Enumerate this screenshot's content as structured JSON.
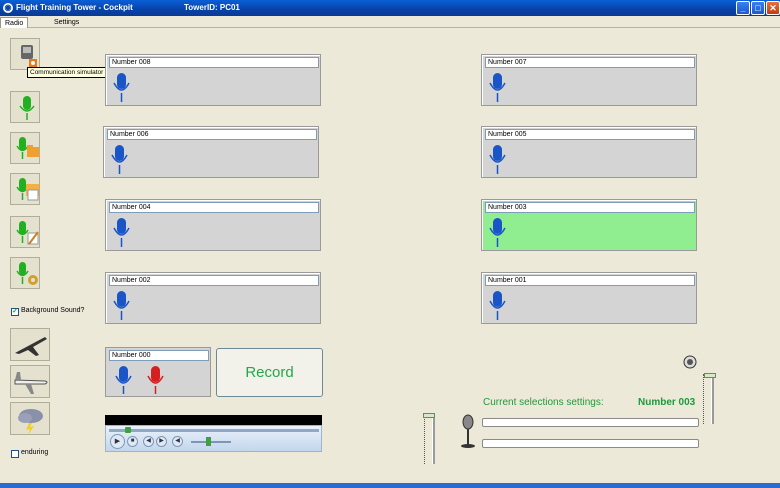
{
  "window": {
    "title": "Flight Training Tower - Cockpit",
    "tower_id": "TowerID: PC01",
    "controls": [
      "minimize-icon",
      "maximize-icon",
      "close-icon"
    ]
  },
  "tabs": [
    {
      "label": "Radio",
      "active": true
    },
    {
      "label": "Settings",
      "active": false
    }
  ],
  "toolbar": {
    "tooltip": "Communication simulator Power Off",
    "background_sound_label": "Background Sound?",
    "background_sound_checked": true,
    "enduring_label": "enduring",
    "enduring_checked": false
  },
  "channels": [
    {
      "name": "Number 008",
      "active": false
    },
    {
      "name": "Number 007",
      "active": false
    },
    {
      "name": "Number 006",
      "active": false
    },
    {
      "name": "Number 005",
      "active": false
    },
    {
      "name": "Number 004",
      "active": false
    },
    {
      "name": "Number 003",
      "active": true
    },
    {
      "name": "Number 002",
      "active": false
    },
    {
      "name": "Number 001",
      "active": false
    },
    {
      "name": "Number 000",
      "active": false
    }
  ],
  "record_label": "Record",
  "current": {
    "label": "Current selections settings:",
    "value": "Number 003"
  },
  "colors": {
    "active_channel": "#90ee90",
    "accent_green": "#1e9a3a",
    "mic_blue": "#1a55c8",
    "mic_red": "#d42020",
    "mic_green": "#22b022"
  }
}
